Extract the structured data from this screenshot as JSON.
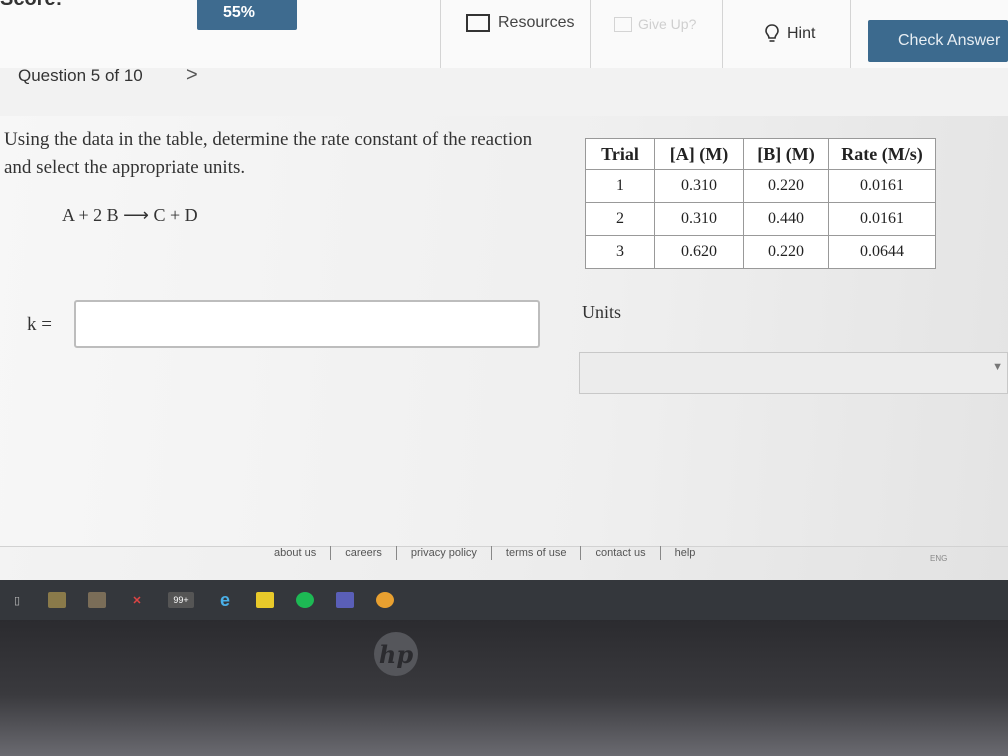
{
  "header": {
    "score_label": "Score:",
    "score_value": "55%",
    "resources_label": "Resources",
    "giveup_label": "Give Up?",
    "hint_label": "Hint",
    "check_label": "Check Answer"
  },
  "question_nav": {
    "label": "Question 5 of 10",
    "next_glyph": ">"
  },
  "question": {
    "prompt": "Using the data in the table, determine the rate constant of the reaction and select the appropriate units.",
    "reaction": "A + 2 B ⟶ C + D",
    "k_label": "k =",
    "k_value": "",
    "units_label": "Units",
    "units_selected": ""
  },
  "table": {
    "headers": [
      "Trial",
      "[A] (M)",
      "[B] (M)",
      "Rate (M/s)"
    ],
    "rows": [
      [
        "1",
        "0.310",
        "0.220",
        "0.0161"
      ],
      [
        "2",
        "0.310",
        "0.440",
        "0.0161"
      ],
      [
        "3",
        "0.620",
        "0.220",
        "0.0644"
      ]
    ]
  },
  "footer": {
    "links": [
      "about us",
      "careers",
      "privacy policy",
      "terms of use",
      "contact us",
      "help"
    ]
  },
  "taskbar": {
    "icons": [
      "windows-icon",
      "task-view-icon",
      "file-explorer-icon",
      "store-icon",
      "app-icon",
      "badge-99-icon",
      "edge-icon",
      "sticky-notes-icon",
      "spotify-icon",
      "teams-icon",
      "app9-icon"
    ],
    "badge": "99+",
    "tray_text": "ENG"
  },
  "bezel": {
    "logo": "hp"
  },
  "colors": {
    "brand": "#3c6a8e",
    "taskbar": "#34373c"
  }
}
